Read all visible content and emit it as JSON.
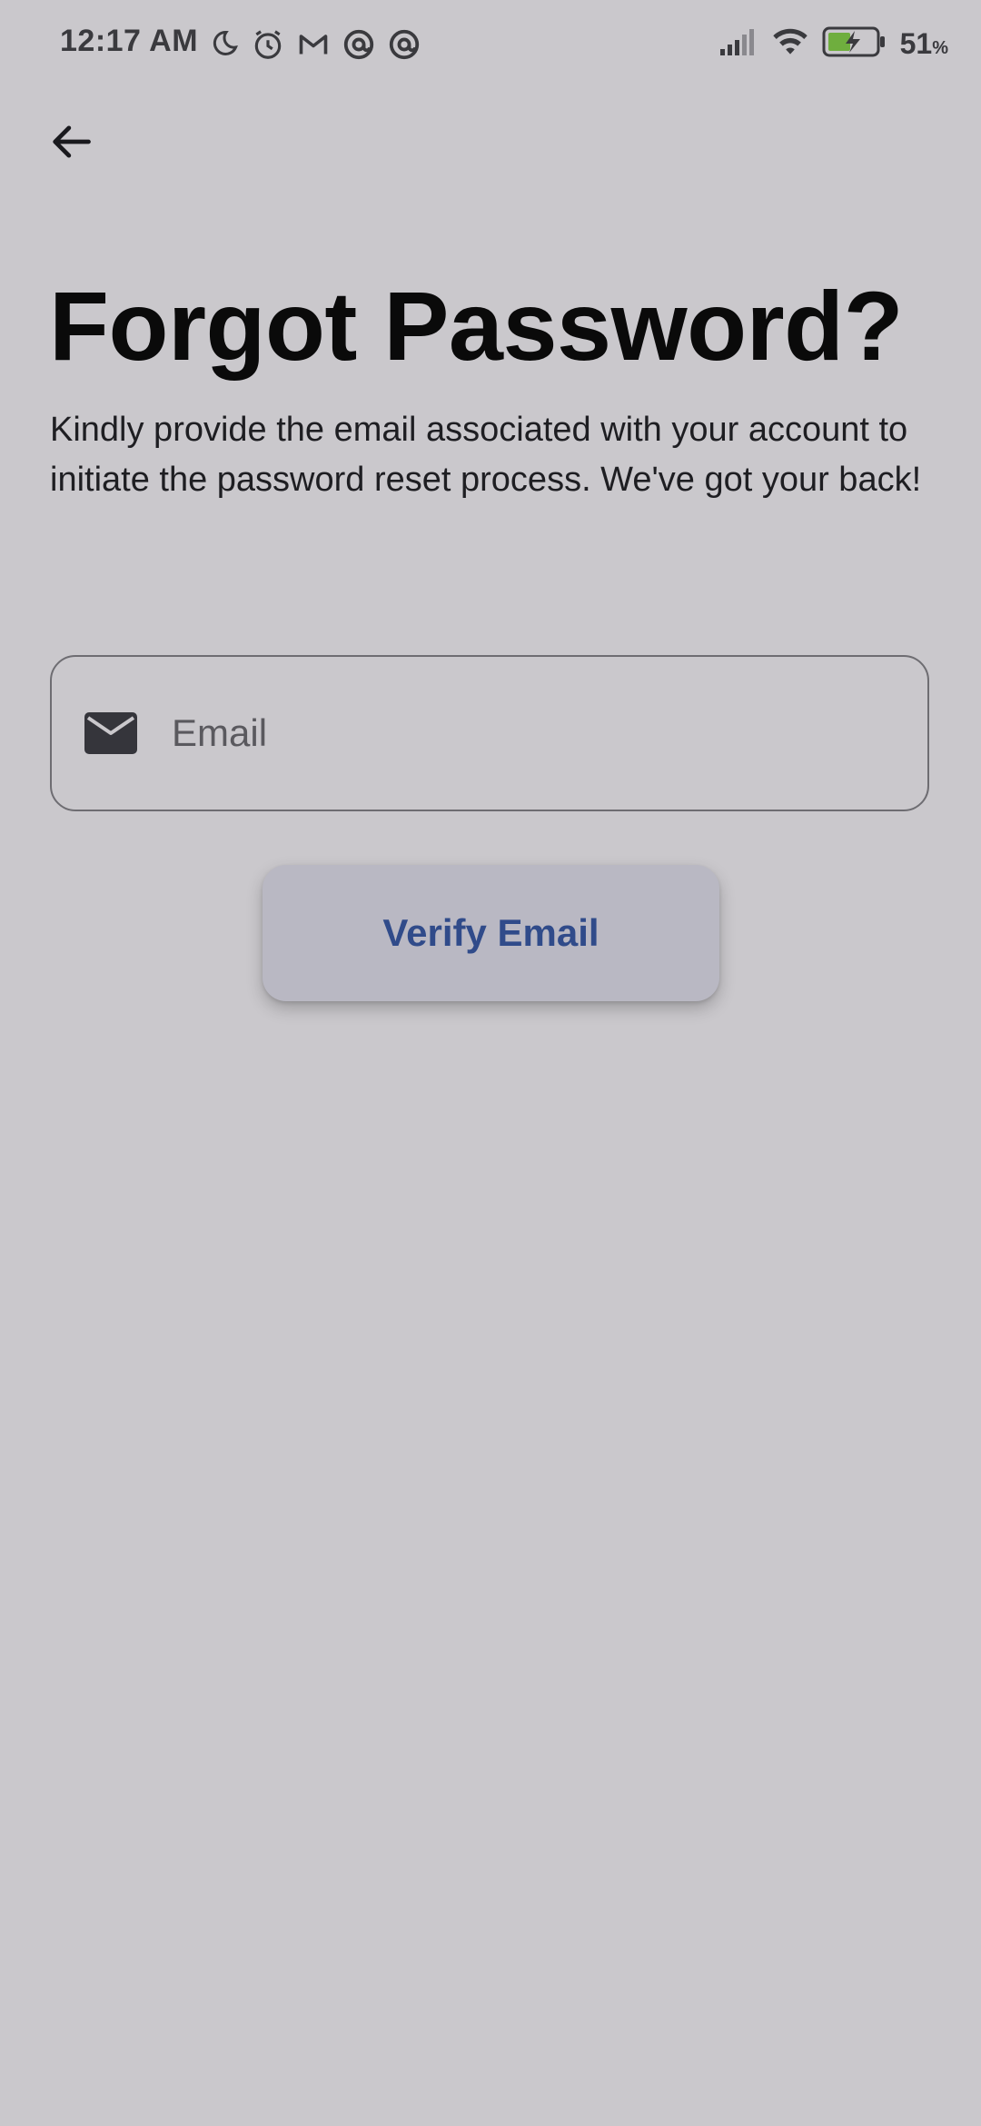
{
  "status_bar": {
    "time": "12:17 AM",
    "battery_level": "51",
    "battery_unit": "%",
    "left_icons": [
      "moon-icon",
      "alarm-icon",
      "gmail-icon",
      "at-sign-icon",
      "at-sign-icon"
    ],
    "right_icons": [
      "signal-icon",
      "wifi-icon",
      "battery-charging-icon"
    ]
  },
  "header": {
    "back_icon": "arrow-left-icon"
  },
  "main": {
    "title": "Forgot Password?",
    "subtitle": "Kindly provide the email associated with your account to initiate the password reset process. We've got your back!",
    "email_field": {
      "icon": "mail-icon",
      "placeholder": "Email",
      "value": ""
    },
    "verify_button_label": "Verify Email"
  },
  "colors": {
    "background": "#cac8cc",
    "button_background": "#b9b8c3",
    "button_text": "#304b8a",
    "field_border": "#6e6d72",
    "battery_charge": "#6fae3e"
  }
}
